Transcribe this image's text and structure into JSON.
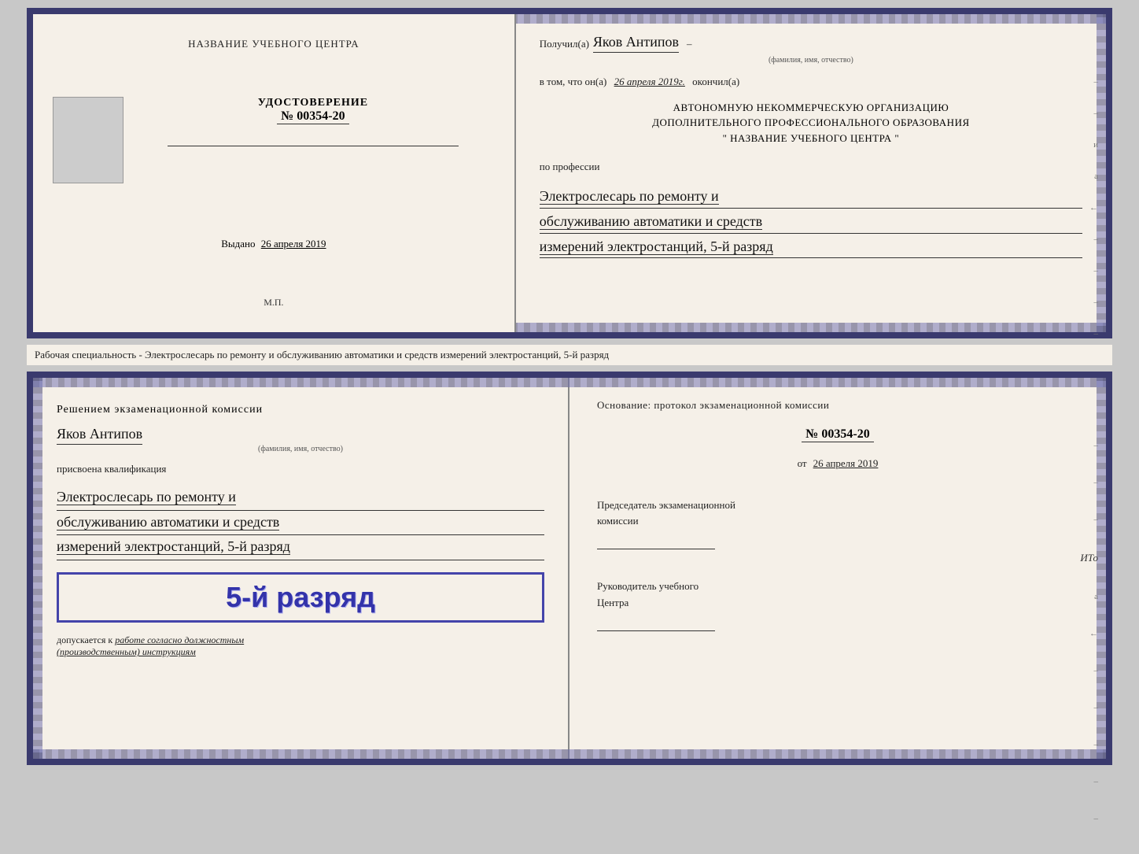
{
  "top_document": {
    "left": {
      "center_title": "НАЗВАНИЕ УЧЕБНОГО ЦЕНТРА",
      "photo_alt": "фото",
      "cert_title": "УДОСТОВЕРЕНИЕ",
      "cert_number": "№ 00354-20",
      "issued_label": "Выдано",
      "issued_date": "26 апреля 2019",
      "mp_label": "М.П."
    },
    "right": {
      "recipient_prefix": "Получил(а)",
      "recipient_name": "Яков Антипов",
      "recipient_sublabel": "(фамилия, имя, отчество)",
      "date_prefix": "в том, что он(а)",
      "date_value": "26 апреля 2019г.",
      "date_suffix": "окончил(а)",
      "org_line1": "АВТОНОМНУЮ НЕКОММЕРЧЕСКУЮ ОРГАНИЗАЦИЮ",
      "org_line2": "ДОПОЛНИТЕЛЬНОГО ПРОФЕССИОНАЛЬНОГО ОБРАЗОВАНИЯ",
      "org_line3": "\"   НАЗВАНИЕ УЧЕБНОГО ЦЕНТРА   \"",
      "profession_prefix": "по профессии",
      "profession_line1": "Электрослесарь по ремонту и",
      "profession_line2": "обслуживанию автоматики и средств",
      "profession_line3": "измерений электростанций, 5-й разряд"
    }
  },
  "separator": {
    "text": "Рабочая специальность - Электрослесарь по ремонту и обслуживанию автоматики и средств измерений электростанций, 5-й разряд"
  },
  "bottom_document": {
    "left": {
      "decision_title": "Решением экзаменационной комиссии",
      "person_name": "Яков Антипов",
      "person_sublabel": "(фамилия, имя, отчество)",
      "assigned_label": "присвоена квалификация",
      "qualification_line1": "Электрослесарь по ремонту и",
      "qualification_line2": "обслуживанию автоматики и средств",
      "qualification_line3": "измерений электростанций, 5-й разряд",
      "rank_text": "5-й разряд",
      "allowed_prefix": "допускается к",
      "allowed_text": "работе согласно должностным",
      "allowed_text2": "(производственным) инструкциям"
    },
    "right": {
      "basis_label": "Основание: протокол экзаменационной комиссии",
      "protocol_number": "№  00354-20",
      "protocol_date_prefix": "от",
      "protocol_date": "26 апреля 2019",
      "chairman_title": "Председатель экзаменационной",
      "chairman_title2": "комиссии",
      "director_title": "Руководитель учебного",
      "director_title2": "Центра",
      "ito_text": "ИТо"
    }
  },
  "colors": {
    "border": "#3a3a6e",
    "rank_color": "#3333aa",
    "rank_border": "#4444aa",
    "background": "#f5f0e8"
  }
}
